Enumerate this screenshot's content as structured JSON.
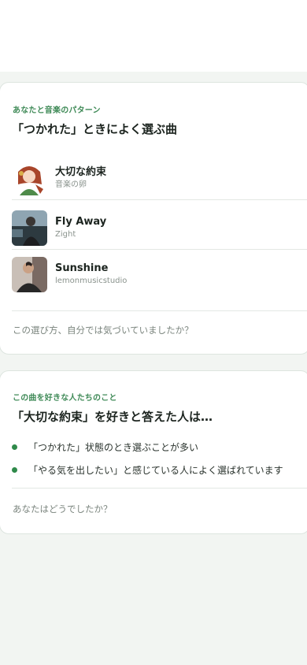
{
  "pattern_card": {
    "eyebrow": "あなたと音楽のパターン",
    "title": "「つかれた」ときによく選ぶ曲",
    "tracks": [
      {
        "title": "大切な約束",
        "artist": "音楽の卵"
      },
      {
        "title": "Fly Away",
        "artist": "Zight"
      },
      {
        "title": "Sunshine",
        "artist": "lemonmusicstudio"
      }
    ],
    "question": "この選び方、自分では気づいていましたか？"
  },
  "people_card": {
    "eyebrow": "この曲を好きな人たちのこと",
    "title": "「大切な約束」を好きと答えた人は…",
    "bullets": [
      "「つかれた」状態のとき選ぶことが多い",
      "「やる気を出したい」と感じている人によく選ばれています"
    ],
    "question": "あなたはどうでしたか？"
  },
  "colors": {
    "accent_green": "#3f8a57",
    "bullet_green": "#2f8a4a",
    "background": "#f2f5f2"
  }
}
